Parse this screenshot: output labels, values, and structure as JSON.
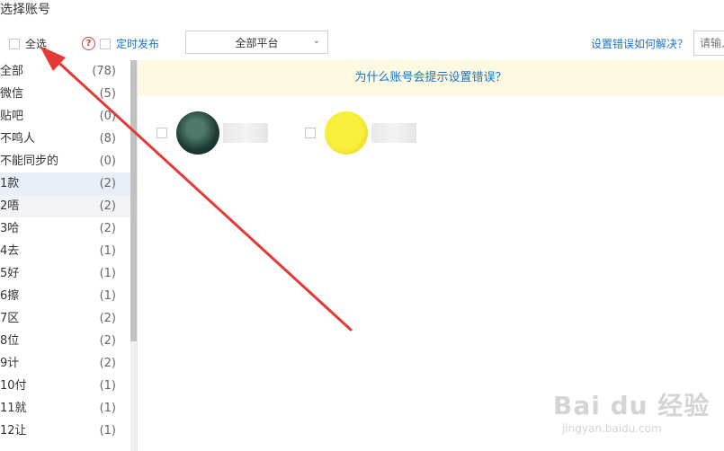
{
  "title": "选择账号",
  "toolbar": {
    "select_all_label": "全选",
    "help_glyph": "?",
    "scheduled_label": "定时发布",
    "platform_value": "全部平台",
    "help_link": "设置错误如何解决？",
    "search_placeholder": "请输入"
  },
  "groups": [
    {
      "name": "全部",
      "count": "(78)"
    },
    {
      "name": "微信",
      "count": "(5)"
    },
    {
      "name": "贴吧",
      "count": "(0)"
    },
    {
      "name": "不鸣人",
      "count": "(8)"
    },
    {
      "name": "不能同步的",
      "count": "(0)"
    },
    {
      "name": "1款",
      "count": "(2)"
    },
    {
      "name": "2唔",
      "count": "(2)"
    },
    {
      "name": "3哈",
      "count": "(2)"
    },
    {
      "name": "4去",
      "count": "(1)"
    },
    {
      "name": "5好",
      "count": "(1)"
    },
    {
      "name": "6擦",
      "count": "(1)"
    },
    {
      "name": "7区",
      "count": "(2)"
    },
    {
      "name": "8位",
      "count": "(2)"
    },
    {
      "name": "9计",
      "count": "(2)"
    },
    {
      "name": "10付",
      "count": "(1)"
    },
    {
      "name": "11就",
      "count": "(1)"
    },
    {
      "name": "12让",
      "count": "(1)"
    }
  ],
  "main": {
    "notice": "为什么账号会提示设置错误？"
  },
  "watermark": {
    "line1": "Bai du 经验",
    "line2": "jingyan.baidu.com"
  },
  "colors": {
    "accent": "#1a73c9",
    "notice_bg": "#fdf9e3",
    "annotation_arrow": "#e53935",
    "help_icon": "#e53935"
  }
}
